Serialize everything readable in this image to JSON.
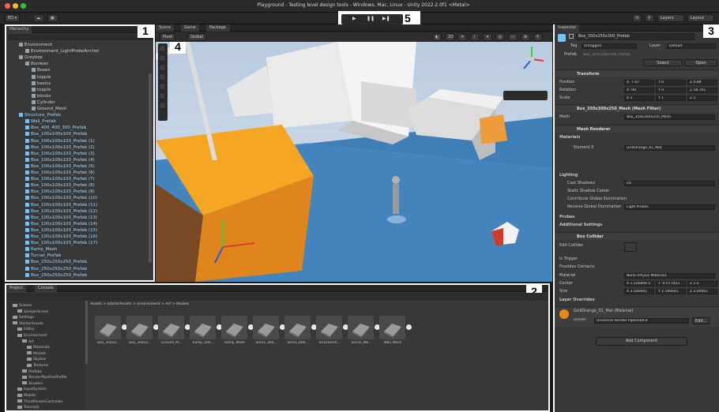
{
  "window": {
    "title": "Playground - Testing level design tools - Windows, Mac, Linux - Unity 2022.2.0f1 <Metal>"
  },
  "toolbar": {
    "account_label": "ED ▾",
    "layers_label": "Layers",
    "layout_label": "Layout"
  },
  "play": {
    "play_icon": "▶",
    "pause_icon": "❚❚",
    "step_icon": "▶❚"
  },
  "callouts": {
    "n1": "1",
    "n2": "2",
    "n3": "3",
    "n4": "4",
    "n5": "5"
  },
  "hierarchy": {
    "tab": "Hierarchy",
    "items": [
      {
        "label": "Environment",
        "indent": 1,
        "kind": "g"
      },
      {
        "label": "Environment_LightProbeAnchor",
        "indent": 2,
        "kind": "g"
      },
      {
        "label": "Greybox",
        "indent": 1,
        "kind": "g"
      },
      {
        "label": "Boolean",
        "indent": 2,
        "kind": "g"
      },
      {
        "label": "Boxes",
        "indent": 3,
        "kind": "g"
      },
      {
        "label": "topple",
        "indent": 3,
        "kind": "g"
      },
      {
        "label": "basics",
        "indent": 3,
        "kind": "g"
      },
      {
        "label": "topple",
        "indent": 3,
        "kind": "g"
      },
      {
        "label": "blocks",
        "indent": 3,
        "kind": "g"
      },
      {
        "label": "Cylinder",
        "indent": 3,
        "kind": "g"
      },
      {
        "label": "Ground_Mesh",
        "indent": 3,
        "kind": "g"
      },
      {
        "label": "Structure_Prefab",
        "indent": 1,
        "kind": "b"
      },
      {
        "label": "Wall_Prefab",
        "indent": 2,
        "kind": "b"
      },
      {
        "label": "Box_400_400_300_Prefab",
        "indent": 2,
        "kind": "b"
      },
      {
        "label": "Box_100x100x100_Prefab",
        "indent": 2,
        "kind": "b"
      },
      {
        "label": "Box_100x100x100_Prefab (1)",
        "indent": 2,
        "kind": "b"
      },
      {
        "label": "Box_100x100x100_Prefab (2)",
        "indent": 2,
        "kind": "b"
      },
      {
        "label": "Box_100x100x100_Prefab (3)",
        "indent": 2,
        "kind": "b"
      },
      {
        "label": "Box_100x100x100_Prefab (4)",
        "indent": 2,
        "kind": "b"
      },
      {
        "label": "Box_100x100x100_Prefab (5)",
        "indent": 2,
        "kind": "b"
      },
      {
        "label": "Box_100x100x100_Prefab (6)",
        "indent": 2,
        "kind": "b"
      },
      {
        "label": "Box_100x100x100_Prefab (7)",
        "indent": 2,
        "kind": "b"
      },
      {
        "label": "Box_100x100x100_Prefab (8)",
        "indent": 2,
        "kind": "b"
      },
      {
        "label": "Box_100x100x100_Prefab (9)",
        "indent": 2,
        "kind": "b"
      },
      {
        "label": "Box_100x100x100_Prefab (10)",
        "indent": 2,
        "kind": "b"
      },
      {
        "label": "Box_100x100x100_Prefab (11)",
        "indent": 2,
        "kind": "b"
      },
      {
        "label": "Box_100x100x100_Prefab (12)",
        "indent": 2,
        "kind": "b"
      },
      {
        "label": "Box_100x100x100_Prefab (13)",
        "indent": 2,
        "kind": "b"
      },
      {
        "label": "Box_100x100x100_Prefab (14)",
        "indent": 2,
        "kind": "b"
      },
      {
        "label": "Box_100x100x100_Prefab (15)",
        "indent": 2,
        "kind": "b"
      },
      {
        "label": "Box_100x100x100_Prefab (16)",
        "indent": 2,
        "kind": "b"
      },
      {
        "label": "Box_100x100x100_Prefab (17)",
        "indent": 2,
        "kind": "b"
      },
      {
        "label": "Ramp_Mesh",
        "indent": 2,
        "kind": "b"
      },
      {
        "label": "Tunnel_Prefab",
        "indent": 2,
        "kind": "b"
      },
      {
        "label": "Box_250x250x250_Prefab",
        "indent": 2,
        "kind": "b"
      },
      {
        "label": "Box_250x250x250_Prefab",
        "indent": 2,
        "kind": "b"
      },
      {
        "label": "Box_250x250x250_Prefab",
        "indent": 2,
        "kind": "b"
      }
    ]
  },
  "scene": {
    "tabs": [
      "Scene",
      "Game",
      "Package Manager"
    ],
    "pivot": "Pivot",
    "global": "Global"
  },
  "inspector": {
    "tab": "Inspector",
    "object_name": "Box_350x250x300_Prefab",
    "tag_label": "Tag",
    "tag_value": "Untagged",
    "layer_label": "Layer",
    "layer_value": "Default",
    "prefab_label": "Prefab",
    "prefab_value": "Box_350x250x300_Prefab",
    "select_btn": "Select",
    "open_btn": "Open",
    "transform": "Transform",
    "position_label": "Position",
    "rotation_label": "Rotation",
    "scale_label": "Scale",
    "pos": [
      "X -7.07",
      "Y 0",
      "Z 0.89"
    ],
    "rot": [
      "X -90",
      "Y 0",
      "Z 58.761"
    ],
    "scl": [
      "X 1",
      "Y 1",
      "Z 1"
    ],
    "mesh_filter": "Box_350x300x250_Mesh (Mesh Filter)",
    "mesh_label": "Mesh",
    "mesh_value": "Box_350x300x250_Mesh",
    "mesh_renderer": "Mesh Renderer",
    "materials_label": "Materials",
    "element_label": "Element 0",
    "element_value": "GridOrange_01_Mat",
    "lighting_label": "Lighting",
    "cast_label": "Cast Shadows",
    "cast_value": "On",
    "static_label": "Static Shadow Caster",
    "contrib_label": "Contribute Global Illumination",
    "receive_label": "Receive Global Illumination",
    "receive_value": "Light Probes",
    "probes_label": "Probes",
    "additional_label": "Additional Settings",
    "box_collider": "Box Collider",
    "edit_collider": "Edit Collider",
    "is_trigger": "Is Trigger",
    "provides_contacts": "Provides Contacts",
    "material_label": "Material",
    "material_value": "None (Physic Material)",
    "center_label": "Center",
    "center": [
      "X 1.52689e-1",
      "Y -0.077952",
      "Z 1.5"
    ],
    "size_label": "Size",
    "size": [
      "X 3.500001",
      "Y 2.500001",
      "Z 3.00001"
    ],
    "layer_overrides": "Layer Overrides",
    "material_name": "GridOrange_01_Mat (Material)",
    "shader_label": "Shader",
    "shader_value": "Universal Render Pipeline/Lit",
    "edit_btn": "Edit...",
    "add_component": "Add Component"
  },
  "project": {
    "tabs": [
      "Project",
      "Console"
    ],
    "breadcrumb": "Assets > StarterAssets > Environment > Art > Models",
    "tree": [
      {
        "label": "Scenes",
        "indent": 1
      },
      {
        "label": "SampleScene",
        "indent": 2
      },
      {
        "label": "Settings",
        "indent": 1
      },
      {
        "label": "StarterAssets",
        "indent": 1
      },
      {
        "label": "Editor",
        "indent": 2
      },
      {
        "label": "Environment",
        "indent": 2
      },
      {
        "label": "Art",
        "indent": 3
      },
      {
        "label": "Materials",
        "indent": 4
      },
      {
        "label": "Models",
        "indent": 4
      },
      {
        "label": "Skybox",
        "indent": 4
      },
      {
        "label": "Textures",
        "indent": 4
      },
      {
        "label": "Prefabs",
        "indent": 3
      },
      {
        "label": "RenderPipelineProfile",
        "indent": 3
      },
      {
        "label": "Shaders",
        "indent": 3
      },
      {
        "label": "InputSystem",
        "indent": 2
      },
      {
        "label": "Mobile",
        "indent": 2
      },
      {
        "label": "ThirdPersonController",
        "indent": 2
      },
      {
        "label": "Tutorials",
        "indent": 2
      }
    ],
    "assets": [
      "Box_350x3...",
      "Box_300x3...",
      "Ground_M...",
      "Ramp_100...",
      "Ramp_Mesh",
      "Stairs_300...",
      "Stairs_600...",
      "StructureA...",
      "Tunnel_Me...",
      "Wall_Mesh"
    ]
  }
}
